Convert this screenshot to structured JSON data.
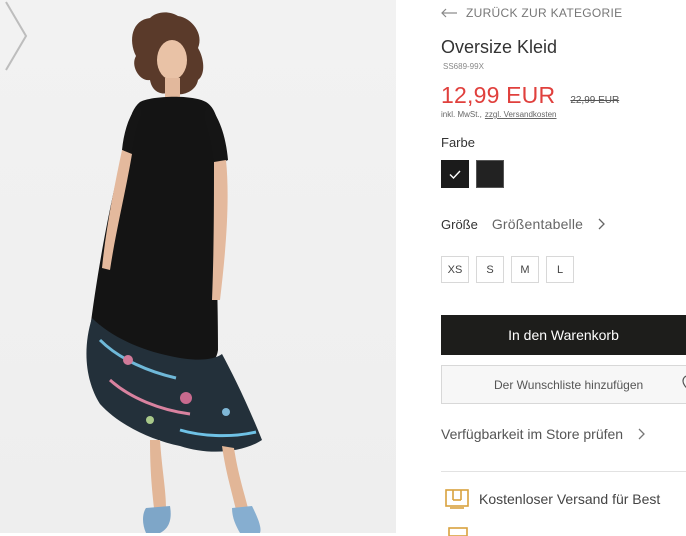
{
  "product_image": {
    "next_icon": "chevron-right-icon"
  },
  "nav": {
    "back_label": "ZURÜCK ZUR KATEGORIE",
    "back_icon": "arrow-left-icon"
  },
  "product": {
    "title": "Oversize Kleid",
    "sku": "SS689-99X",
    "price_new": "12,99 EUR",
    "price_old": "22,99 EUR",
    "tax_text": "inkl. MwSt.,",
    "shipping_link": "zzgl. Versandkosten",
    "price_color": "#e0403d"
  },
  "color": {
    "label": "Farbe",
    "swatches": [
      {
        "name": "schwarz",
        "hex": "#1b1b1b",
        "selected": true
      },
      {
        "name": "schwarz-2",
        "hex": "#222222",
        "selected": false
      }
    ]
  },
  "size": {
    "label": "Größe",
    "table_link": "Größentabelle",
    "options": [
      "XS",
      "S",
      "M",
      "L"
    ]
  },
  "actions": {
    "add_to_cart": "In den Warenkorb",
    "wishlist": "Der Wunschliste hinzufügen",
    "wishlist_icon": "heart-icon",
    "store_check": "Verfügbarkeit im Store prüfen"
  },
  "benefits": {
    "free_shipping": "Kostenloser Versand für Best",
    "shipping_icon": "box-icon",
    "accent": "#d9a23e"
  }
}
